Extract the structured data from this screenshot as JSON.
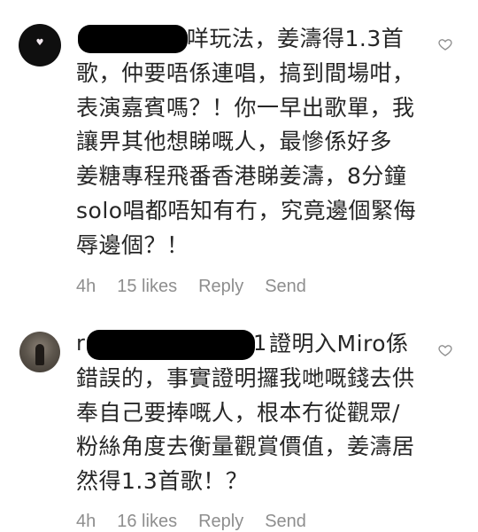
{
  "comments": [
    {
      "text": "咩玩法，姜濤得1.3首\n歌，仲要唔係連唱，搞到間場咁，\n表演嘉賓嗎？！你一早出歌單，我\n讓畀其他想睇嘅人，最慘係好多\n姜糖專程飛番香港睇姜濤，8分鐘\nsolo唱都唔知有冇，究竟邊個緊侮\n辱邊個？！",
      "time": "4h",
      "likes": "15 likes",
      "reply": "Reply",
      "send": "Send"
    },
    {
      "username_fragment_left": "r",
      "username_fragment_right": "1",
      "text": "證明入Miro係\n錯誤的，事實證明攞我哋嘅錢去供\n奉自己要捧嘅人，根本冇從觀眾/\n粉絲角度去衡量觀賞價值，姜濤居\n然得1.3首歌！？",
      "time": "4h",
      "likes": "16 likes",
      "reply": "Reply",
      "send": "Send"
    }
  ],
  "colors": {
    "text": "#262626",
    "meta": "#8e8e8e",
    "redaction": "#000000",
    "background": "#ffffff"
  },
  "icons": {
    "like": "heart-outline-icon"
  }
}
